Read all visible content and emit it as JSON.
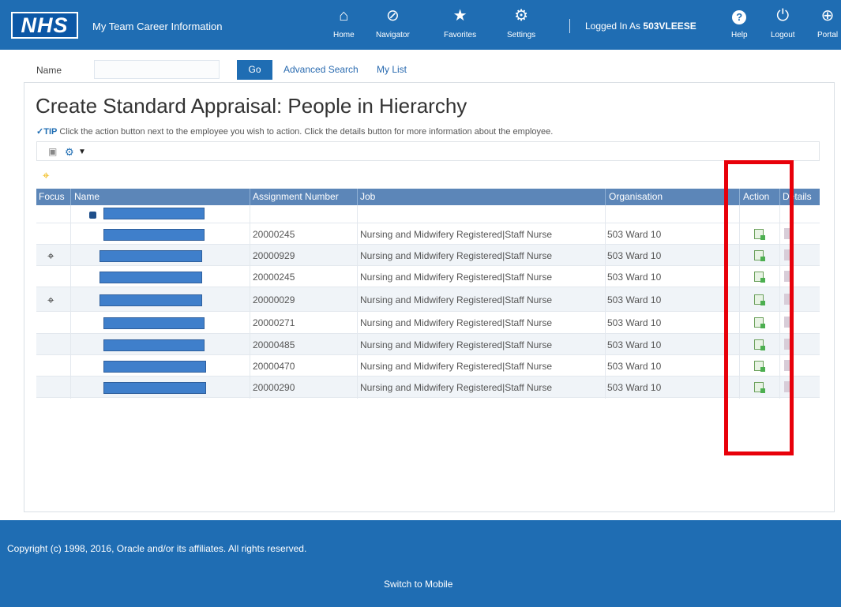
{
  "header": {
    "logo": "NHS",
    "app_title": "My Team Career Information",
    "nav": [
      {
        "label": "Home",
        "icon": "home-icon",
        "glyph": "⌂"
      },
      {
        "label": "Navigator",
        "icon": "compass-icon",
        "glyph": "⊘"
      },
      {
        "label": "Favorites",
        "icon": "star-icon",
        "glyph": "★"
      },
      {
        "label": "Settings",
        "icon": "gear-icon",
        "glyph": "⚙"
      }
    ],
    "logged_in_prefix": "Logged In As",
    "username": "503VLEESE",
    "right_nav": [
      {
        "label": "Help",
        "icon": "help-icon",
        "glyph": "?"
      },
      {
        "label": "Logout",
        "icon": "power-icon",
        "glyph": "⏻"
      },
      {
        "label": "Portal",
        "icon": "globe-icon",
        "glyph": "⊕"
      }
    ]
  },
  "search": {
    "name_label": "Name",
    "name_value": "",
    "go_label": "Go",
    "advanced_search_label": "Advanced Search",
    "my_list_label": "My List"
  },
  "page": {
    "title": "Create Standard Appraisal: People in Hierarchy",
    "tip_prefix": "TIP",
    "tip_text": "Click the action button next to the employee you wish to action. Click the details button for more information about the employee."
  },
  "table": {
    "headers": {
      "focus": "Focus",
      "name": "Name",
      "assignment": "Assignment Number",
      "job": "Job",
      "organisation": "Organisation",
      "action": "Action",
      "details": "Details"
    },
    "rows": [
      {
        "assignment": "20000245",
        "job": "Nursing and Midwifery Registered|Staff Nurse",
        "organisation": "503 Ward 10",
        "focus": false
      },
      {
        "assignment": "20000929",
        "job": "Nursing and Midwifery Registered|Staff Nurse",
        "organisation": "503 Ward 10",
        "focus": true
      },
      {
        "assignment": "20000245",
        "job": "Nursing and Midwifery Registered|Staff Nurse",
        "organisation": "503 Ward 10",
        "focus": false
      },
      {
        "assignment": "20000029",
        "job": "Nursing and Midwifery Registered|Staff Nurse",
        "organisation": "503 Ward 10",
        "focus": true
      },
      {
        "assignment": "20000271",
        "job": "Nursing and Midwifery Registered|Staff Nurse",
        "organisation": "503 Ward 10",
        "focus": false
      },
      {
        "assignment": "20000485",
        "job": "Nursing and Midwifery Registered|Staff Nurse",
        "organisation": "503 Ward 10",
        "focus": false
      },
      {
        "assignment": "20000470",
        "job": "Nursing and Midwifery Registered|Staff Nurse",
        "organisation": "503 Ward 10",
        "focus": false
      },
      {
        "assignment": "20000290",
        "job": "Nursing and Midwifery Registered|Staff Nurse",
        "organisation": "503 Ward 10",
        "focus": false
      }
    ]
  },
  "footer": {
    "copyright": "Copyright (c) 1998, 2016, Oracle and/or its affiliates. All rights reserved.",
    "switch_mobile": "Switch to Mobile"
  },
  "colors": {
    "brand_blue": "#1f6db3",
    "header_table": "#5c86b8",
    "highlight_red": "#e8000a"
  }
}
